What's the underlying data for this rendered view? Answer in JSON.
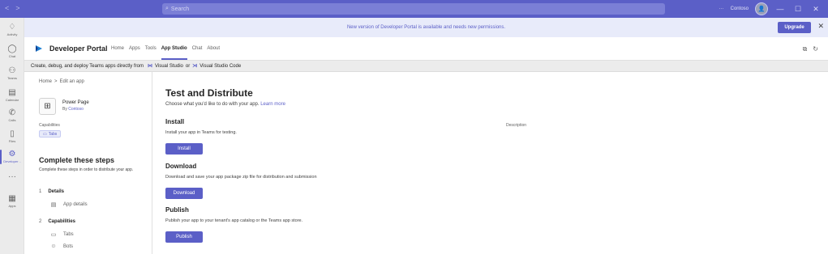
{
  "titlebar": {
    "search_placeholder": "Search",
    "org_name": "Contoso",
    "minimize": "—",
    "maximize": "☐",
    "close": "✕"
  },
  "rail": {
    "items": [
      {
        "label": "Activity",
        "icon": "bell-icon",
        "glyph": "🔔"
      },
      {
        "label": "Chat",
        "icon": "chat-icon",
        "glyph": "💬"
      },
      {
        "label": "Teams",
        "icon": "teams-icon",
        "glyph": "👥"
      },
      {
        "label": "Calendar",
        "icon": "calendar-icon",
        "glyph": "▦"
      },
      {
        "label": "Calls",
        "icon": "phone-icon",
        "glyph": "✆"
      },
      {
        "label": "Files",
        "icon": "file-icon",
        "glyph": "🗋"
      },
      {
        "label": "Developer ..",
        "icon": "developer-icon",
        "glyph": "⚙"
      },
      {
        "label": "",
        "icon": "more-icon",
        "glyph": "···"
      },
      {
        "label": "Apps",
        "icon": "apps-icon",
        "glyph": "▦"
      }
    ]
  },
  "banner": {
    "message": "New version of Developer Portal is available and needs new permissions.",
    "upgrade_label": "Upgrade",
    "close": "✕"
  },
  "app_header": {
    "title": "Developer Portal",
    "tabs": [
      "Home",
      "Apps",
      "Tools",
      "App Studio",
      "Chat",
      "About"
    ],
    "active_tab": "App Studio"
  },
  "infobar": {
    "text": "Create, debug, and deploy Teams apps directly from",
    "vs_label": "Visual Studio",
    "or": "or",
    "vscode_label": "Visual Studio Code"
  },
  "leftpanel": {
    "breadcrumb_home": "Home",
    "breadcrumb_sep": ">",
    "breadcrumb_current": "Edit an app",
    "app_name": "Power Page",
    "app_by_prefix": "By",
    "app_by_company": "Contoso",
    "capabilities_label": "Capabilities",
    "capability_chip": "Tabs",
    "steps_title": "Complete these steps",
    "steps_desc": "Complete these steps in order to distribute your app.",
    "steps": [
      {
        "num": "1",
        "label": "Details",
        "items": [
          "App details"
        ]
      },
      {
        "num": "2",
        "label": "Capabilities",
        "items": [
          "Tabs",
          "Bots"
        ]
      }
    ]
  },
  "main": {
    "title": "Test and Distribute",
    "subtitle": "Choose what you'd like to do with your app.",
    "learn_more": "Learn more",
    "description_label": "Description",
    "sections": [
      {
        "title": "Install",
        "desc": "Install your app in Teams for testing.",
        "button": "Install"
      },
      {
        "title": "Download",
        "desc": "Download and save your app package zip file for distribution and submission",
        "button": "Download"
      },
      {
        "title": "Publish",
        "desc": "Publish your app to your tenant's app catalog or the Teams app store.",
        "button": "Publish"
      }
    ]
  },
  "colors": {
    "accent": "#5b5fc7",
    "titlebar": "#5b5fc7",
    "banner_bg": "#e8ebfa"
  }
}
